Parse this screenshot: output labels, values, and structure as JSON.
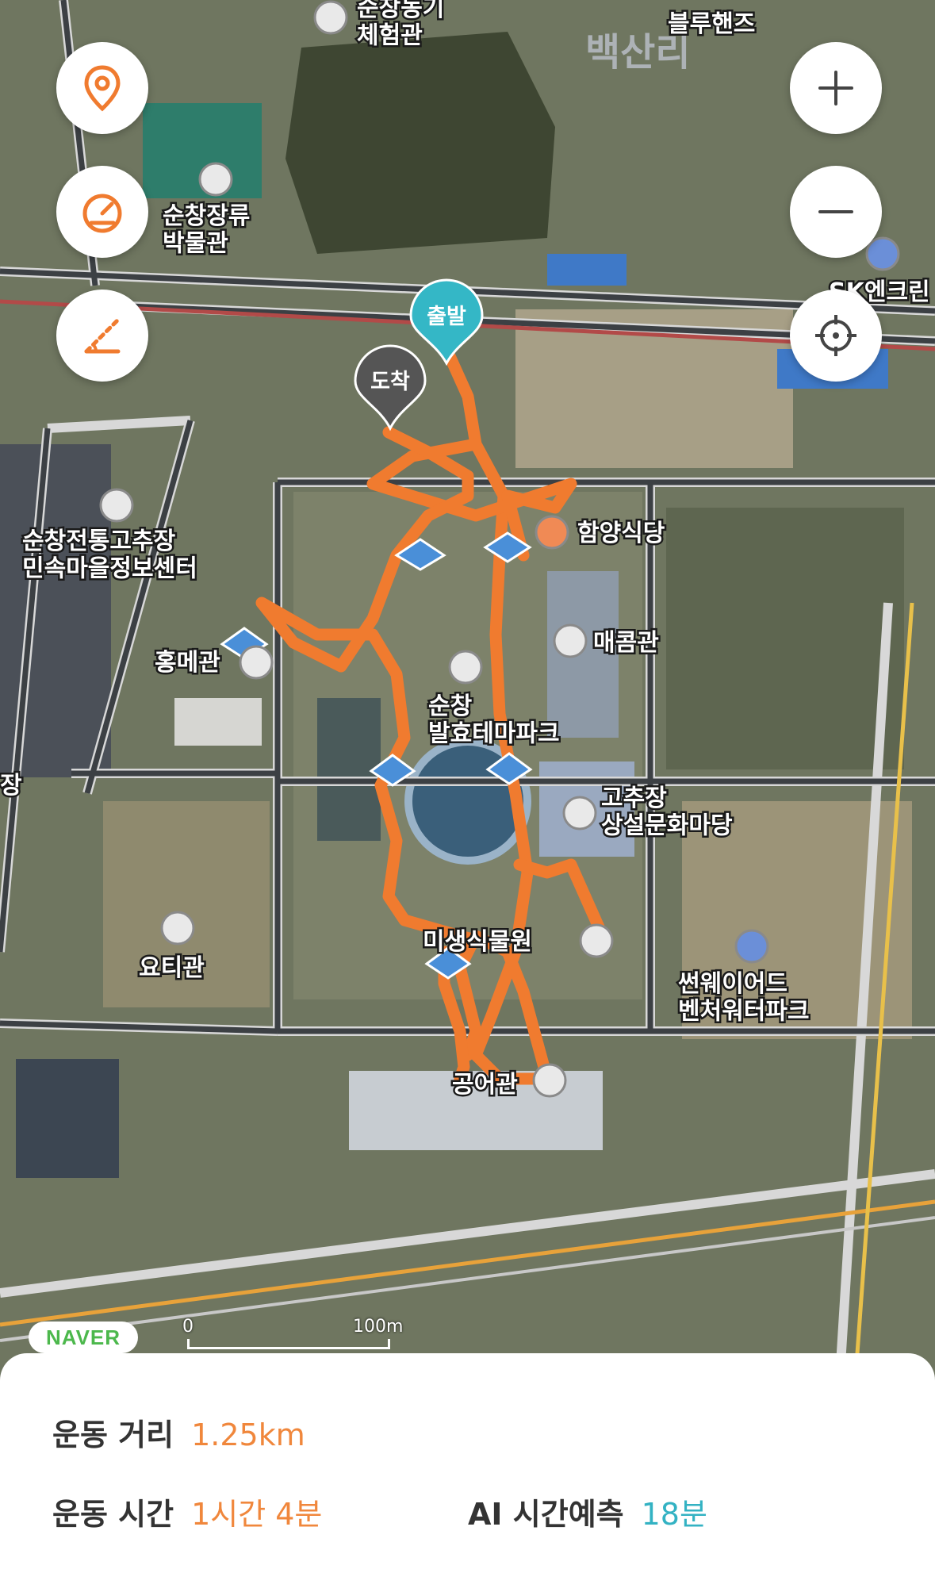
{
  "map": {
    "area_label": "백산리",
    "markers": {
      "start": "출발",
      "end": "도착"
    },
    "places": [
      {
        "name": "순창농기\n체험관"
      },
      {
        "name": "블루핸즈"
      },
      {
        "name": "순창장류\n박물관"
      },
      {
        "name": "SK엔크린"
      },
      {
        "name": "순창전통고추장\n민속마을정보센터"
      },
      {
        "name": "함양식당"
      },
      {
        "name": "홍메관"
      },
      {
        "name": "매콤관"
      },
      {
        "name": "순창\n발효테마파크"
      },
      {
        "name": "고추장\n상설문화마당"
      },
      {
        "name": "요티관"
      },
      {
        "name": "미생식물원"
      },
      {
        "name": "썬웨이어드\n벤처워터파크"
      },
      {
        "name": "공어관"
      },
      {
        "name": "장"
      }
    ],
    "buttons": {
      "location": "location-pin-icon",
      "speedometer": "speedometer-icon",
      "distance": "distance-icon",
      "zoom_in": "+",
      "zoom_out": "−",
      "recenter": "crosshair-icon"
    },
    "naver_logo": "NAVER",
    "scale": {
      "zero": "0",
      "label": "100m"
    }
  },
  "stats": {
    "distance_label": "운동 거리",
    "distance_value": "1.25km",
    "time_label": "운동 시간",
    "time_value": "1시간 4분",
    "ai_label": "AI 시간예측",
    "ai_value": "18분"
  },
  "colors": {
    "route": "#f07b2f",
    "accent": "#f07b2f",
    "start_marker": "#34b7c6",
    "end_marker": "#555555",
    "ai_value": "#33b2c3"
  }
}
